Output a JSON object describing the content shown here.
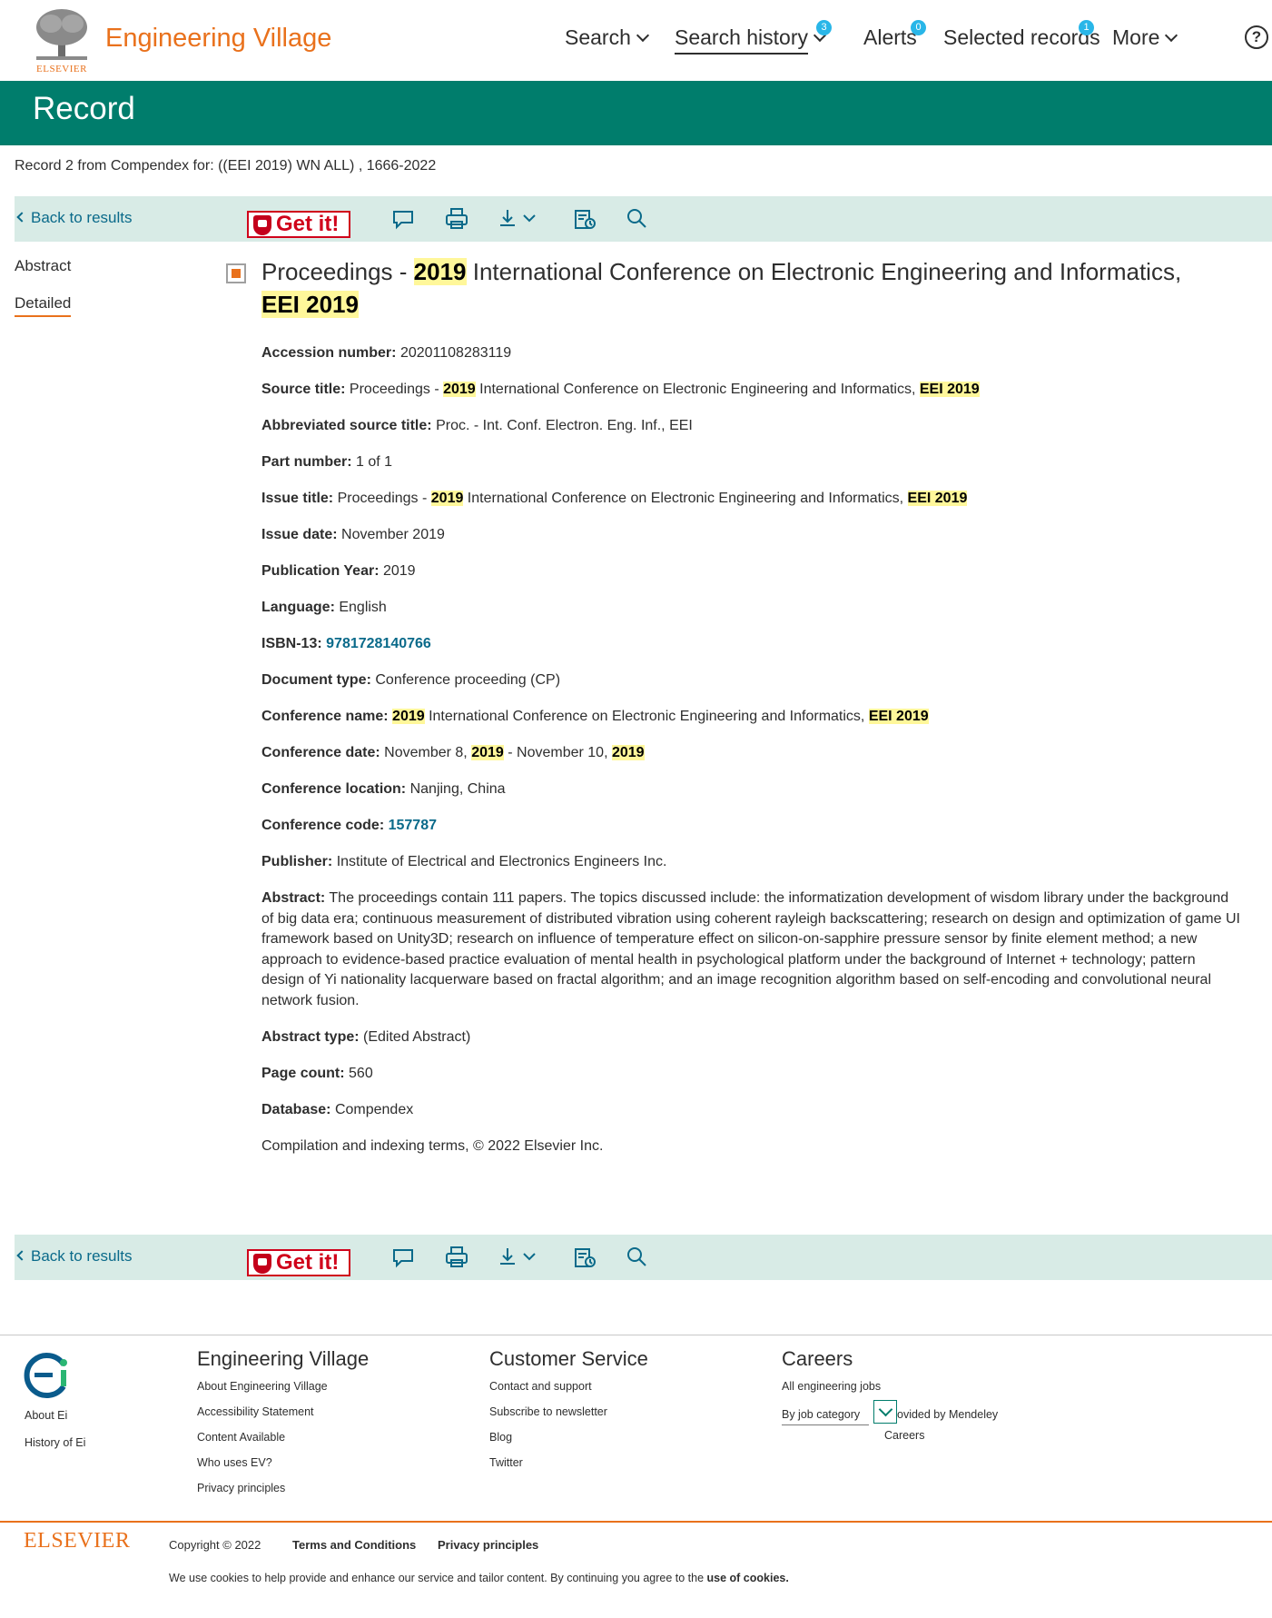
{
  "header": {
    "logo_word": "ELSEVIER",
    "brand": "Engineering Village",
    "nav": {
      "search": "Search",
      "search_history": "Search history",
      "search_history_badge": "3",
      "alerts": "Alerts",
      "alerts_badge": "0",
      "selected_records": "Selected records",
      "selected_records_badge": "1",
      "more": "More",
      "help": "?"
    }
  },
  "page": {
    "title": "Record",
    "query": "Record 2 from Compendex for: ((EEI 2019) WN ALL) , 1666-2022"
  },
  "toolbar": {
    "back": "Back to results",
    "getit": "Get it!",
    "icons": [
      "comment-icon",
      "print-icon",
      "download-icon",
      "history-icon",
      "search-icon"
    ]
  },
  "side_tabs": {
    "abstract": "Abstract",
    "detailed": "Detailed"
  },
  "record": {
    "title_parts": [
      "Proceedings - ",
      "2019",
      " International Conference on Electronic Engineering and Informatics, ",
      "EEI 2019"
    ],
    "accession_label": "Accession number:",
    "accession": "20201108283119",
    "source_label": "Source title:",
    "source_parts": [
      "Proceedings - ",
      "2019",
      " International Conference on Electronic Engineering and Informatics, ",
      "EEI 2019"
    ],
    "abbrev_label": "Abbreviated source title:",
    "abbrev": "Proc. - Int. Conf. Electron. Eng. Inf., EEI",
    "part_label": "Part number:",
    "part": "1 of 1",
    "issue_title_label": "Issue title:",
    "issue_title_parts": [
      "Proceedings - ",
      "2019",
      " International Conference on Electronic Engineering and Informatics, ",
      "EEI 2019"
    ],
    "issue_date_label": "Issue date:",
    "issue_date": "November 2019",
    "pub_year_label": "Publication Year:",
    "pub_year": "2019",
    "language_label": "Language:",
    "language": "English",
    "isbn_label": "ISBN-13:",
    "isbn": "9781728140766",
    "doctype_label": "Document type:",
    "doctype": "Conference proceeding (CP)",
    "conf_name_label": "Conference name:",
    "conf_name_parts": [
      "2019",
      " International Conference on Electronic Engineering and Informatics, ",
      "EEI 2019"
    ],
    "conf_date_label": "Conference date:",
    "conf_date_parts": [
      "November 8, ",
      "2019",
      " - November 10, ",
      "2019"
    ],
    "conf_loc_label": "Conference location:",
    "conf_loc": "Nanjing, China",
    "conf_code_label": "Conference code:",
    "conf_code": "157787",
    "publisher_label": "Publisher:",
    "publisher": "Institute of Electrical and Electronics Engineers Inc.",
    "abstract_label": "Abstract:",
    "abstract": "The proceedings contain 111 papers. The topics discussed include: the informatization development of wisdom library under the background of big data era; continuous measurement of distributed vibration using coherent rayleigh backscattering; research on design and optimization of game UI framework based on Unity3D; research on influence of temperature effect on silicon-on-sapphire pressure sensor by finite element method; a new approach to evidence-based practice evaluation of mental health in psychological platform under the background of Internet + technology; pattern design of Yi nationality lacquerware based on fractal algorithm; and an image recognition algorithm based on self-encoding and convolutional neural network fusion.",
    "abstract_type_label": "Abstract type:",
    "abstract_type": "(Edited Abstract)",
    "page_count_label": "Page count:",
    "page_count": "560",
    "database_label": "Database:",
    "database": "Compendex",
    "copyright": "Compilation and indexing terms, © 2022 Elsevier Inc."
  },
  "footer": {
    "about_ei": "About Ei",
    "history_ei": "History of Ei",
    "col_ev": {
      "heading": "Engineering Village",
      "links": [
        "About Engineering Village",
        "Accessibility Statement",
        "Content Available",
        "Who uses EV?",
        "Privacy principles"
      ]
    },
    "col_cs": {
      "heading": "Customer Service",
      "links": [
        "Contact and support",
        "Subscribe to newsletter",
        "Blog",
        "Twitter"
      ]
    },
    "col_careers": {
      "heading": "Careers",
      "all_jobs": "All engineering jobs",
      "by_category": "By job category",
      "mendeley_1": "ovided by Mendeley",
      "mendeley_2": "Careers"
    },
    "elsevier": "ELSEVIER",
    "copyright": "Copyright © 2022",
    "terms": "Terms and Conditions",
    "privacy": "Privacy principles",
    "cookies_text": "We use cookies to help provide and enhance our service and tailor content. By continuing you agree to the ",
    "cookies_link": "use of cookies."
  },
  "colors": {
    "brand_orange": "#e9711c",
    "banner_green": "#007d6c",
    "toolbar_bg": "#d8ebe6",
    "link_blue": "#0a6a8a",
    "highlight": "#fff79a",
    "badge_blue": "#29b6e8"
  }
}
